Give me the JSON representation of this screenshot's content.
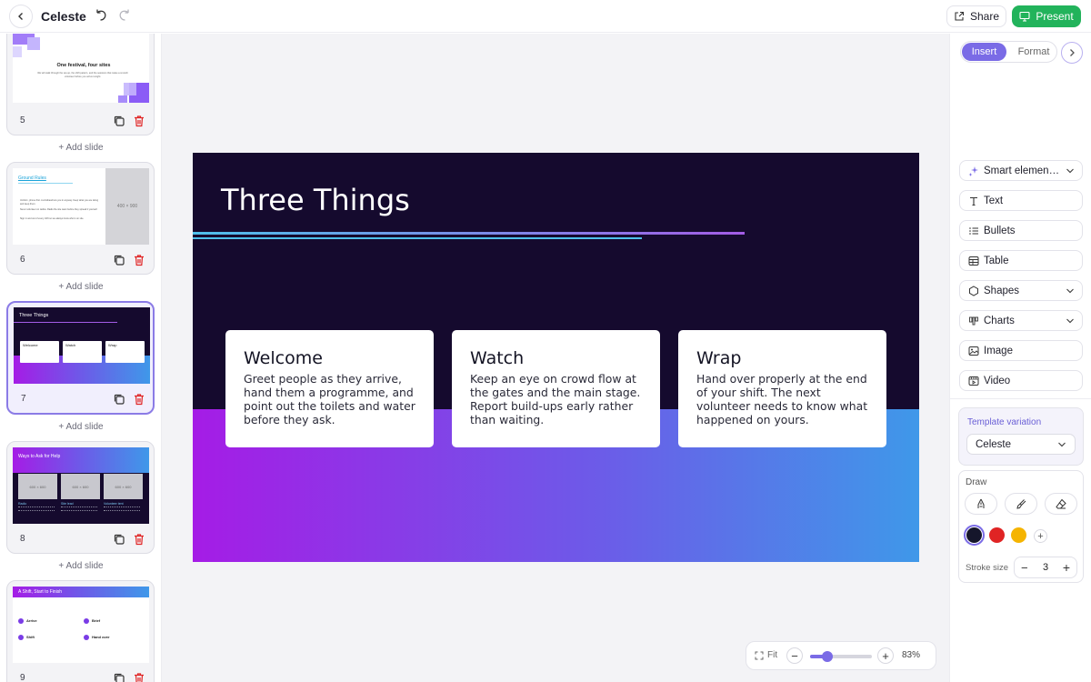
{
  "app": {
    "title": "Celeste"
  },
  "toolbar": {
    "share_label": "Share",
    "present_label": "Present"
  },
  "slides_panel": {
    "add_slide_label": "+ Add slide",
    "slides": [
      {
        "number": "5",
        "thumb_title": "One festival, four sites",
        "thumb_body": "We will walk through the set-up, the shift pattern, and the sessions that make a smooth volunteer before you arrive tonight."
      },
      {
        "number": "6",
        "thumb_title": "Ground Rules",
        "thumb_placeholder": "400 × 900",
        "thumb_bullets": [
          "Uniform, phone first. A wristband lets you in anyway. Keep what you are doing and keep them.",
          "Never volunteer on radios. Radio the site team before they spread it yourself.",
          "Sign in and out of every shift so we always know who is on site."
        ]
      },
      {
        "number": "7",
        "thumb_title": "Three Things",
        "thumb_cards": [
          "Welcome",
          "Watch",
          "Wrap"
        ]
      },
      {
        "number": "8",
        "thumb_title": "Ways to Ask for Help",
        "thumb_placeholders": [
          "600 × 600",
          "600 × 600",
          "600 × 600"
        ],
        "thumb_labels": [
          "Radio",
          "Site lead",
          "Volunteer tent"
        ]
      },
      {
        "number": "9",
        "thumb_title": "A Shift, Start to Finish",
        "thumb_steps": [
          "Arrive",
          "Brief",
          "Shift",
          "Hand over"
        ]
      }
    ]
  },
  "slide": {
    "title": "Three Things",
    "cards": [
      {
        "title": "Welcome",
        "body": "Greet people as they arrive, hand them a programme, and point out the toilets and water before they ask."
      },
      {
        "title": "Watch",
        "body": "Keep an eye on crowd flow at the gates and the main stage. Report build-ups early rather than waiting."
      },
      {
        "title": "Wrap",
        "body": "Hand over properly at the end of your shift. The next volunteer needs to know what happened on yours."
      }
    ]
  },
  "zoom": {
    "fit_label": "Fit",
    "percent_label": "83%",
    "level_fraction": 0.28
  },
  "right_panel": {
    "tabs": {
      "insert": "Insert",
      "format": "Format"
    },
    "items": [
      {
        "label": "Smart elemen…",
        "icon": "sparkle-icon",
        "has_chevron": true
      },
      {
        "label": "Text",
        "icon": "text-icon",
        "has_chevron": false
      },
      {
        "label": "Bullets",
        "icon": "list-icon",
        "has_chevron": false
      },
      {
        "label": "Table",
        "icon": "table-icon",
        "has_chevron": false
      },
      {
        "label": "Shapes",
        "icon": "shapes-icon",
        "has_chevron": true
      },
      {
        "label": "Charts",
        "icon": "chart-icon",
        "has_chevron": true
      },
      {
        "label": "Image",
        "icon": "image-icon",
        "has_chevron": false
      },
      {
        "label": "Video",
        "icon": "video-icon",
        "has_chevron": false
      }
    ],
    "template_variation": {
      "label": "Template variation",
      "value": "Celeste"
    },
    "draw": {
      "label": "Draw",
      "colors": [
        "#15162b",
        "#e02424",
        "#f5b400"
      ],
      "stroke_label": "Stroke size",
      "stroke_value": "3"
    }
  },
  "colors": {
    "accent": "#7a6be6",
    "present": "#22b35b",
    "slide_dark": "#150a2e"
  }
}
